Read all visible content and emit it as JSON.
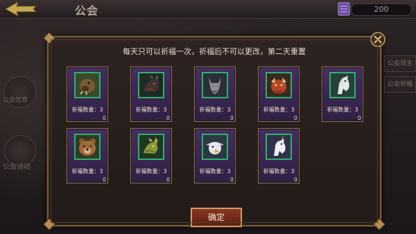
{
  "header": {
    "title": "公会",
    "currency": "200"
  },
  "side_left": {
    "item1": "公会信息",
    "item2": "公会活动"
  },
  "side_right": {
    "item1": "公会领主",
    "item2": "公会祈福"
  },
  "modal": {
    "instruction": "每天只可以祈福一次，祈福后不可以更改，第二天重置",
    "confirm_label": "确定",
    "cards": [
      {
        "animal": "wild-boar",
        "count": "0",
        "blessing": "祈福数量：3"
      },
      {
        "animal": "black-dragon",
        "count": "0",
        "blessing": "祈福数量：3"
      },
      {
        "animal": "grey-wolf",
        "count": "0",
        "blessing": "祈福数量：3"
      },
      {
        "animal": "red-beast",
        "count": "0",
        "blessing": "祈福数量：3"
      },
      {
        "animal": "white-horse",
        "count": "0",
        "blessing": "祈福数量：3"
      },
      {
        "animal": "brown-bear",
        "count": "0",
        "blessing": "祈福数量：3"
      },
      {
        "animal": "green-dragon",
        "count": "0",
        "blessing": "祈福数量：3"
      },
      {
        "animal": "griffin",
        "count": "0",
        "blessing": "祈福数量：3"
      },
      {
        "animal": "unicorn",
        "count": "0",
        "blessing": "祈福数量：3"
      }
    ]
  },
  "colors": {
    "card_purple": "#3d2a55",
    "portrait_green": "#2fb06f",
    "gold_border": "#8e7650",
    "button_red": "#7a2e1d"
  }
}
